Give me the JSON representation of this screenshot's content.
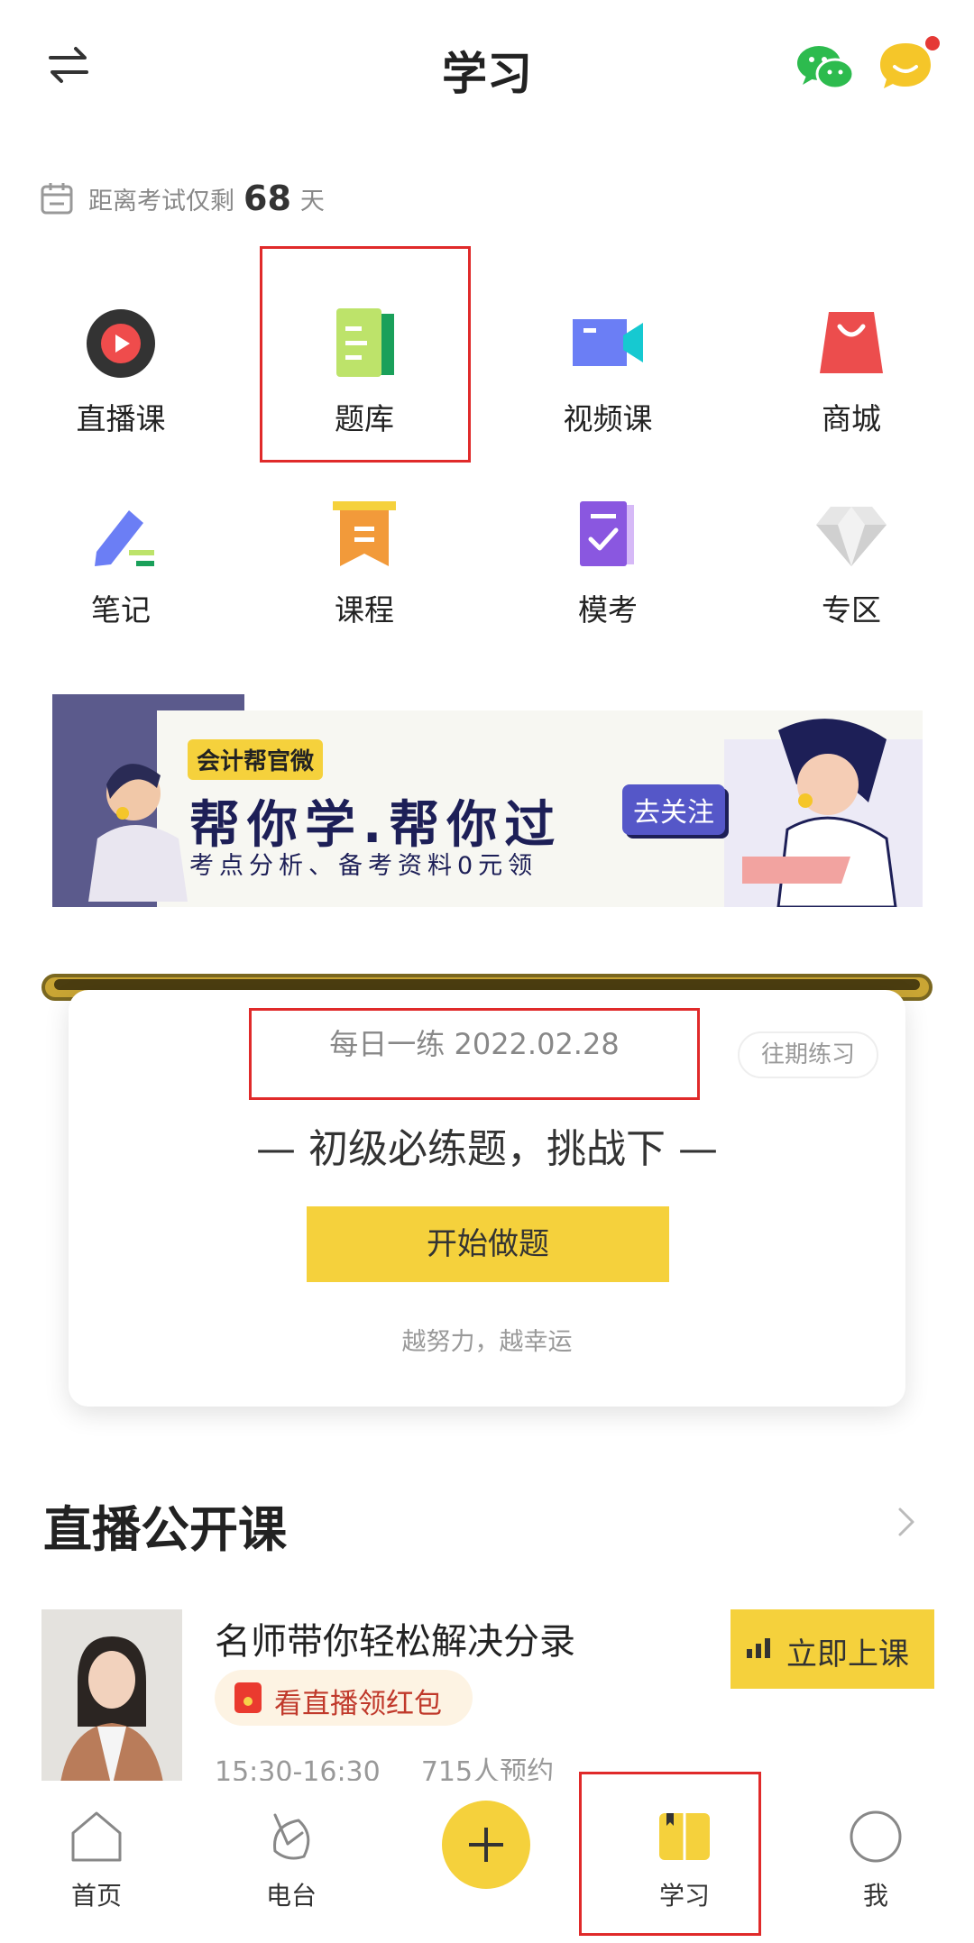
{
  "header": {
    "title": "学习",
    "icons": [
      "switch-icon",
      "wechat-icon",
      "message-icon"
    ]
  },
  "countdown": {
    "prefix": "距离考试仅剩",
    "days": "68",
    "suffix": "天"
  },
  "grid": [
    {
      "label": "直播课",
      "icon": "live-icon"
    },
    {
      "label": "题库",
      "icon": "question-bank-icon"
    },
    {
      "label": "视频课",
      "icon": "video-icon"
    },
    {
      "label": "商城",
      "icon": "shop-icon"
    },
    {
      "label": "笔记",
      "icon": "note-icon"
    },
    {
      "label": "课程",
      "icon": "course-icon"
    },
    {
      "label": "模考",
      "icon": "mock-exam-icon"
    },
    {
      "label": "专区",
      "icon": "zone-icon"
    }
  ],
  "banner": {
    "tag": "会计帮官微",
    "headline": "帮你学.帮你过",
    "subline": "考点分析、备考资料0元领",
    "cta": "去关注"
  },
  "daily": {
    "title": "每日一练 2022.02.28",
    "past_button": "往期练习",
    "subtitle": "— 初级必练题，挑战下 —",
    "start_button": "开始做题",
    "motto": "越努力，越幸运"
  },
  "live": {
    "heading": "直播公开课",
    "course_title": "名师带你轻松解决分录",
    "redpack_label": "看直播领红包",
    "time": "15:30-16:30",
    "reservations": "715人预约",
    "attend_button": "立即上课"
  },
  "nav": [
    {
      "label": "首页",
      "icon": "home-icon"
    },
    {
      "label": "电台",
      "icon": "radio-icon"
    },
    {
      "label": "",
      "icon": "plus-icon"
    },
    {
      "label": "学习",
      "icon": "study-icon"
    },
    {
      "label": "我",
      "icon": "profile-icon"
    }
  ],
  "colors": {
    "accent": "#f5d13c",
    "highlight_border": "#e02a2a"
  }
}
